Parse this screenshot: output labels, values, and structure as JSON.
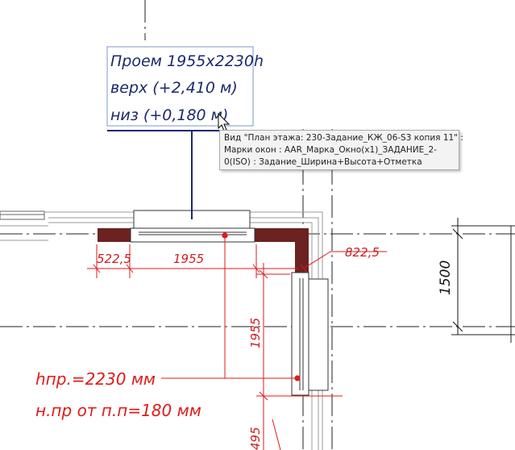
{
  "tag": {
    "line1": "Проем 1955x2230h",
    "line2": "верх (+2,410 м)",
    "line3": "низ (+0,180 м)"
  },
  "tooltip": {
    "line1": "Вид \"План этажа: 230-Задание_КЖ_06-S3 копия 11\" :",
    "line2": "Марки окон : AAR_Марка_Окно(x1)_ЗАДАНИЕ_2-",
    "line3": "0(ISO) : Задание_Ширина+Высота+Отметка"
  },
  "dimensions": {
    "left_offset": "522,5",
    "width_horizontal": "1955",
    "corner": "822,5",
    "width_vertical": "1955",
    "grid_spacing": "1500",
    "bottom_partial": "495"
  },
  "notes": {
    "line1": "hпр.=2230 мм",
    "line2": "н.пр от п.п=180 мм"
  },
  "colors": {
    "tag_text": "#1a2a6c",
    "tag_border": "#7a97c9",
    "dimension_red": "#e01a1a",
    "wall_cut": "#6b2220",
    "grid_line": "#222222"
  }
}
